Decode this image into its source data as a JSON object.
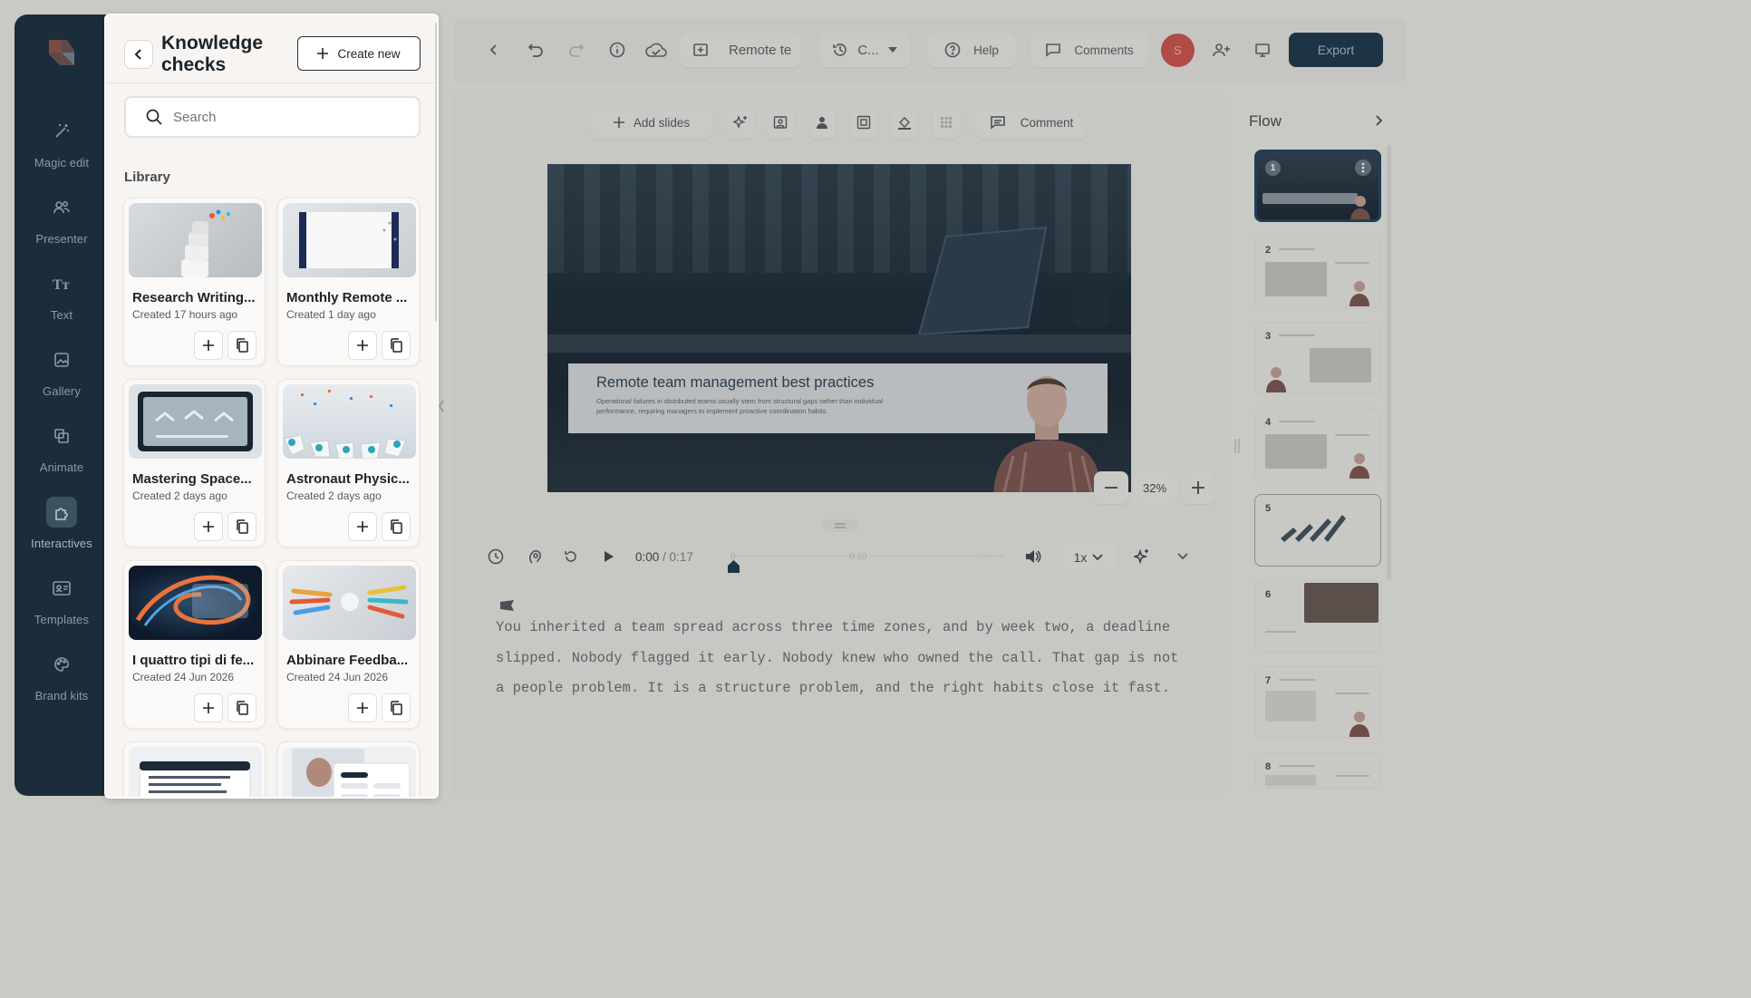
{
  "rail": {
    "items": [
      {
        "label": "Magic edit",
        "icon": "magic-wand-icon"
      },
      {
        "label": "Presenter",
        "icon": "presenter-icon"
      },
      {
        "label": "Text",
        "icon": "text-icon"
      },
      {
        "label": "Gallery",
        "icon": "gallery-icon"
      },
      {
        "label": "Animate",
        "icon": "animate-icon"
      },
      {
        "label": "Interactives",
        "icon": "interactives-icon"
      },
      {
        "label": "Templates",
        "icon": "templates-icon"
      },
      {
        "label": "Brand kits",
        "icon": "palette-icon"
      }
    ],
    "active": "Interactives"
  },
  "knowledge": {
    "title": "Knowledge checks",
    "create_label": "Create new",
    "search_placeholder": "Search",
    "library_label": "Library",
    "cards": [
      {
        "title": "Research Writing...",
        "date": "Created 17 hours ago"
      },
      {
        "title": "Monthly Remote ...",
        "date": "Created 1 day ago"
      },
      {
        "title": "Mastering Space...",
        "date": "Created 2 days ago"
      },
      {
        "title": "Astronaut Physic...",
        "date": "Created 2 days ago"
      },
      {
        "title": "I quattro tipi di fe...",
        "date": "Created 24 Jun 2026"
      },
      {
        "title": "Abbinare Feedba...",
        "date": "Created 24 Jun 2026"
      }
    ]
  },
  "topbar": {
    "project_name": "Remote te",
    "version_label": "C...",
    "help_label": "Help",
    "comments_label": "Comments",
    "avatar_initial": "S",
    "export_label": "Export"
  },
  "canvas_toolbar": {
    "add_slides_label": "Add slides",
    "comment_label": "Comment"
  },
  "slide": {
    "title": "Remote team management best practices",
    "body": "Operational failures in distributed teams usually stem from structural gaps rather than individual performance, requiring managers to implement proactive coordination habits."
  },
  "zoom": {
    "value": "32%"
  },
  "timeline": {
    "current": "0:00",
    "total": "/ 0:17",
    "ticks": [
      "0",
      "0:10",
      "0:20"
    ],
    "speed": "1x"
  },
  "script": {
    "text": "You inherited a team spread across three time zones, and by week two, a deadline slipped. Nobody flagged it early. Nobody knew who owned the call. That gap is not a people problem. It is a structure problem, and the right habits close it fast."
  },
  "flow": {
    "title": "Flow",
    "slides": [
      "1",
      "2",
      "3",
      "4",
      "5",
      "6",
      "7",
      "8"
    ],
    "active_slide": "1"
  }
}
